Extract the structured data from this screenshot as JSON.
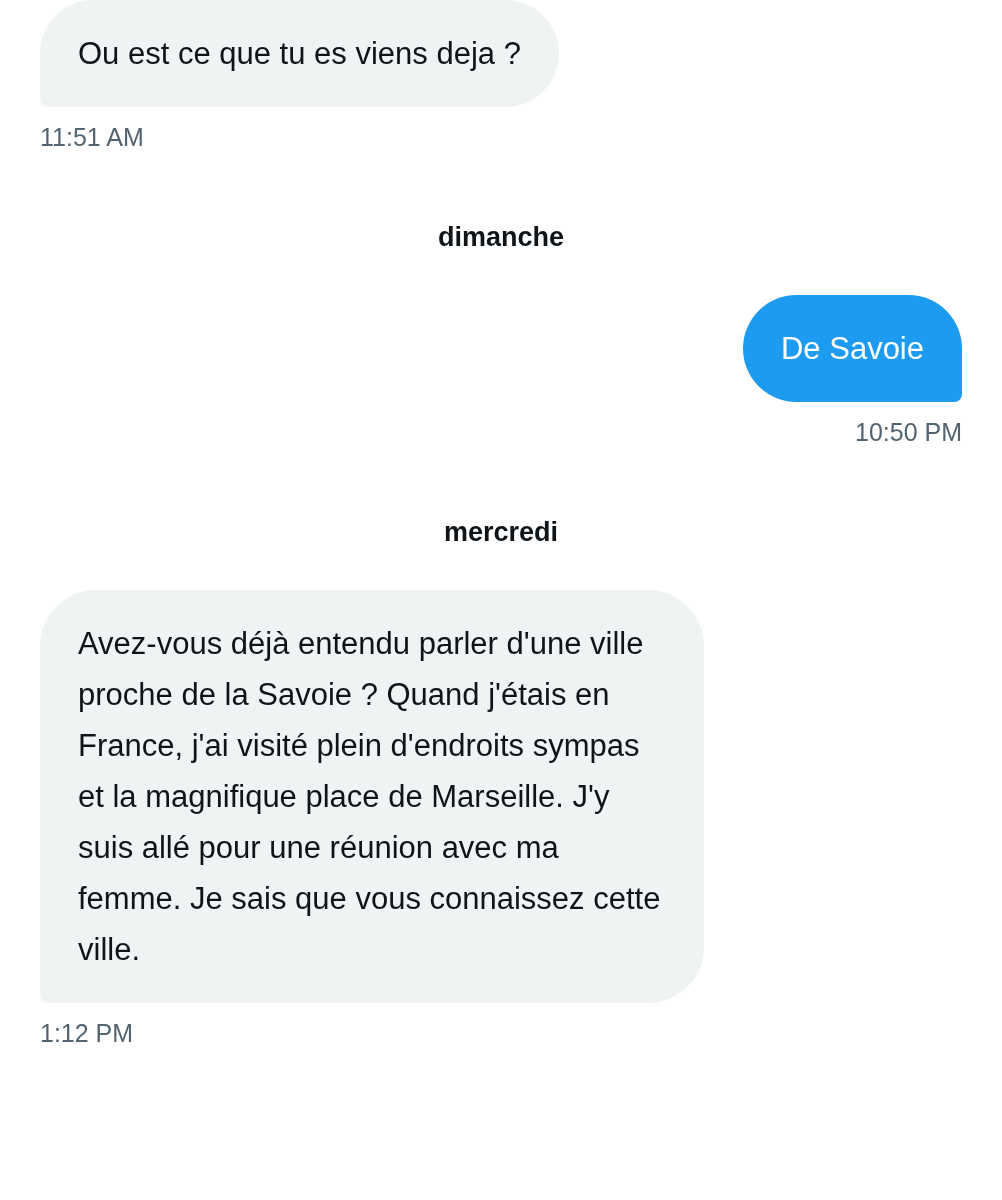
{
  "conversation": [
    {
      "kind": "received",
      "text": "Ou est ce que tu es viens deja ?",
      "time": "11:51 AM"
    },
    {
      "kind": "day",
      "text": "dimanche"
    },
    {
      "kind": "sent",
      "text": "De Savoie",
      "time": "10:50 PM"
    },
    {
      "kind": "day",
      "text": "mercredi"
    },
    {
      "kind": "received",
      "text": "Avez-vous déjà entendu parler d'une ville proche de la Savoie ? Quand j'étais en France, j'ai visité plein d'endroits sympas et la magnifique place de Marseille. J'y suis allé pour une réunion avec ma femme. Je sais que vous connaissez cette ville.",
      "time": "1:12 PM"
    }
  ]
}
